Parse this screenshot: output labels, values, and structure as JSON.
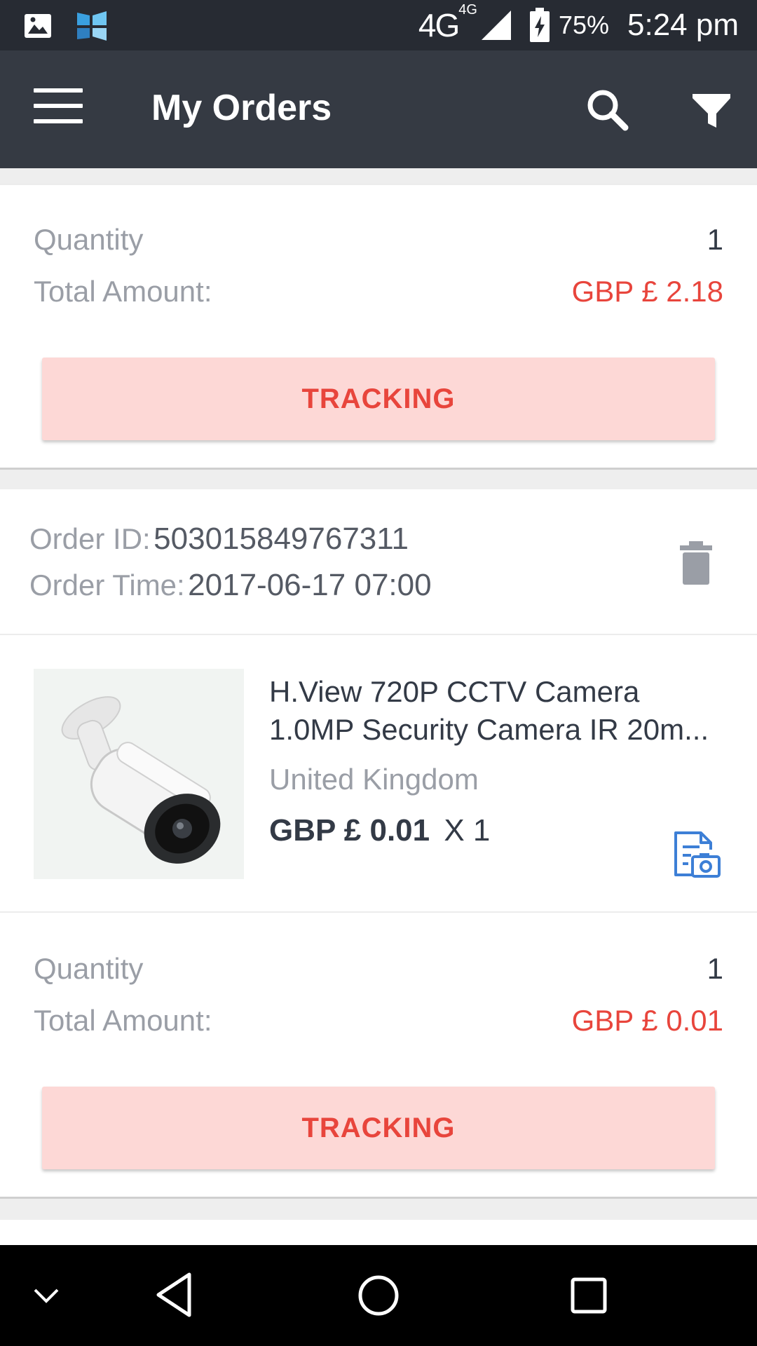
{
  "status_bar": {
    "network": "4G",
    "network_sub": "4G",
    "battery_percent": "75%",
    "time": "5:24 pm"
  },
  "app_bar": {
    "title": "My Orders"
  },
  "orders": [
    {
      "quantity_label": "Quantity",
      "quantity": "1",
      "total_label": "Total Amount:",
      "total": "GBP  £ 2.18",
      "tracking_label": "TRACKING"
    },
    {
      "order_id_label": "Order ID:",
      "order_id": "503015849767311",
      "order_time_label": "Order Time:",
      "order_time": "2017-06-17 07:00",
      "product": {
        "name_line1": "H.View 720P CCTV Camera",
        "name_line2": "1.0MP Security Camera IR 20m...",
        "country": "United Kingdom",
        "price": "GBP  £ 0.01",
        "qty": "X 1"
      },
      "quantity_label": "Quantity",
      "quantity": "1",
      "total_label": "Total Amount:",
      "total": "GBP  £ 0.01",
      "tracking_label": "TRACKING"
    }
  ],
  "icons": {
    "menu": "menu-icon",
    "search": "search-icon",
    "filter": "filter-icon",
    "delete": "trash-icon",
    "review": "photo-review-icon",
    "back": "back-icon",
    "home": "home-icon",
    "recents": "recents-icon",
    "hide": "chevron-down-icon"
  },
  "colors": {
    "app_bar": "#353a43",
    "status_bar": "#272b33",
    "accent_red": "#e8453c",
    "tracking_bg": "#fdd8d6",
    "icon_blue": "#3d7fd6"
  }
}
